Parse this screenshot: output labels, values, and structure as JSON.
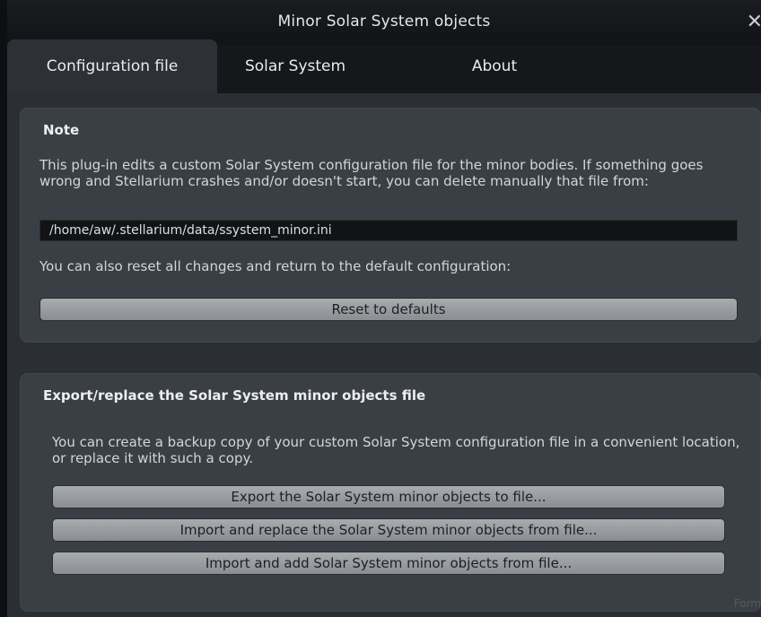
{
  "window": {
    "title": "Minor Solar System objects",
    "close_label": "✕"
  },
  "tabs": [
    {
      "label": "Configuration file",
      "active": true
    },
    {
      "label": "Solar System",
      "active": false
    },
    {
      "label": "About",
      "active": false
    }
  ],
  "note_group": {
    "title": "Note",
    "description": "This plug-in edits a custom Solar System configuration file for the minor bodies. If something goes wrong and Stellarium crashes and/or doesn't start, you can delete manually that file from:",
    "path": "/home/aw/.stellarium/data/ssystem_minor.ini",
    "reset_text": "You can also reset all changes and return to the default configuration:",
    "reset_button": "Reset to defaults"
  },
  "export_group": {
    "title": "Export/replace the Solar System minor objects file",
    "description": "You can create a backup copy of your custom Solar System configuration file in a convenient location, or replace it with such a copy.",
    "buttons": [
      "Export the Solar System minor objects to file...",
      "Import and replace the Solar System minor objects from file...",
      "Import and add Solar System minor objects from file..."
    ]
  },
  "bottom_hint": "Form"
}
